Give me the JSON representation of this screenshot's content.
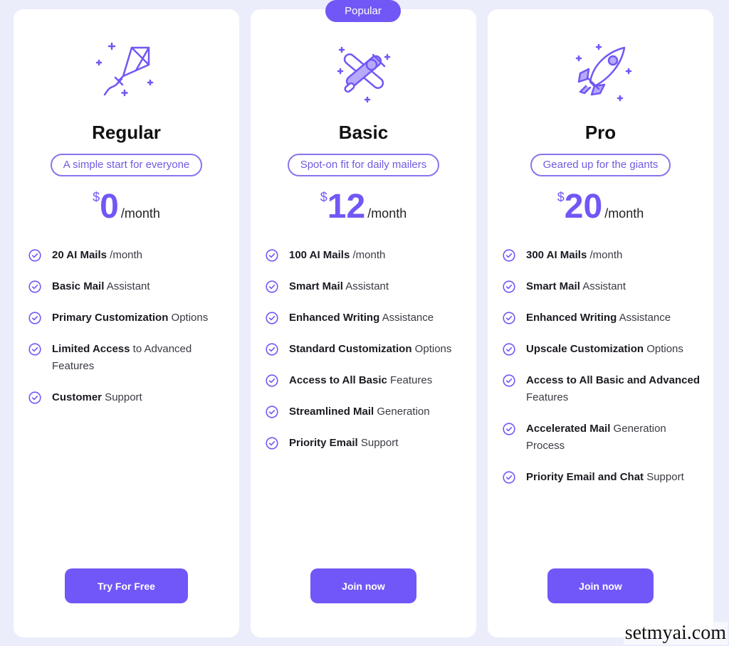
{
  "accent_color": "#7157f5",
  "background_color": "#ebedfb",
  "plans": [
    {
      "name": "Regular",
      "icon": "kite-icon",
      "tagline": "A simple start for everyone",
      "currency": "$",
      "price": "0",
      "period": "/month",
      "features": [
        {
          "bold": "20 AI Mails",
          "rest": " /month"
        },
        {
          "bold": "Basic Mail",
          "rest": " Assistant"
        },
        {
          "bold": "Primary Customization",
          "rest": " Options"
        },
        {
          "bold": "Limited Access",
          "rest": " to Advanced Features"
        },
        {
          "bold": "Customer",
          "rest": " Support"
        }
      ],
      "cta": "Try For Free"
    },
    {
      "name": "Basic",
      "badge": "Popular",
      "icon": "airplane-icon",
      "tagline": "Spot-on fit for daily mailers",
      "currency": "$",
      "price": "12",
      "period": "/month",
      "features": [
        {
          "bold": "100 AI Mails",
          "rest": " /month"
        },
        {
          "bold": "Smart Mail",
          "rest": " Assistant"
        },
        {
          "bold": "Enhanced Writing",
          "rest": " Assistance"
        },
        {
          "bold": "Standard Customization",
          "rest": " Options"
        },
        {
          "bold": "Access to All Basic",
          "rest": " Features"
        },
        {
          "bold": "Streamlined Mail",
          "rest": " Generation"
        },
        {
          "bold": "Priority Email",
          "rest": " Support"
        }
      ],
      "cta": "Join now"
    },
    {
      "name": "Pro",
      "icon": "rocket-icon",
      "tagline": "Geared up for the giants",
      "currency": "$",
      "price": "20",
      "period": "/month",
      "features": [
        {
          "bold": "300 AI Mails",
          "rest": " /month"
        },
        {
          "bold": "Smart Mail",
          "rest": " Assistant"
        },
        {
          "bold": "Enhanced Writing",
          "rest": " Assistance"
        },
        {
          "bold": "Upscale Customization",
          "rest": " Options"
        },
        {
          "bold": "Access to All Basic and Advanced",
          "rest": " Features"
        },
        {
          "bold": "Accelerated Mail",
          "rest": " Generation Process"
        },
        {
          "bold": "Priority Email and Chat",
          "rest": " Support"
        }
      ],
      "cta": "Join now"
    }
  ],
  "watermark": "setmyai.com"
}
